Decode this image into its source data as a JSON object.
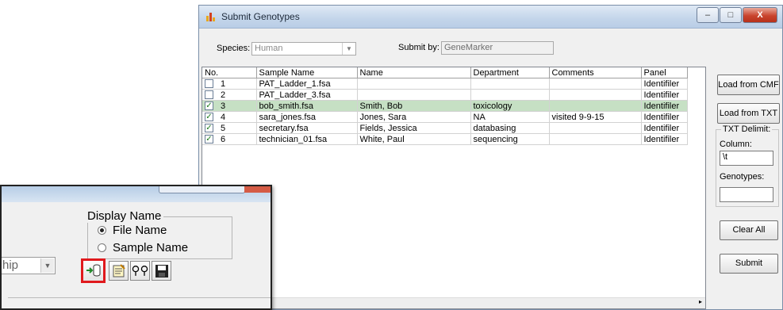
{
  "window": {
    "title": "Submit Genotypes",
    "controls": [
      "–",
      "□",
      "X"
    ]
  },
  "form": {
    "species_label": "Species:",
    "species_value": "Human",
    "submit_by_label": "Submit by:",
    "submit_by_value": "GeneMarker"
  },
  "grid": {
    "columns": [
      "No.",
      "Sample Name",
      "Name",
      "Department",
      "Comments",
      "Panel"
    ],
    "rows": [
      {
        "no": "1",
        "checked": false,
        "sample": "PAT_Ladder_1.fsa",
        "name": "",
        "dept": "",
        "comments": "",
        "panel": "Identifiler"
      },
      {
        "no": "2",
        "checked": false,
        "sample": "PAT_Ladder_3.fsa",
        "name": "",
        "dept": "",
        "comments": "",
        "panel": "Identifiler"
      },
      {
        "no": "3",
        "checked": true,
        "sample": "bob_smith.fsa",
        "name": "Smith, Bob",
        "dept": "toxicology",
        "comments": "",
        "panel": "Identifiler"
      },
      {
        "no": "4",
        "checked": true,
        "sample": "sara_jones.fsa",
        "name": "Jones, Sara",
        "dept": "NA",
        "comments": "visited 9-9-15",
        "panel": "Identifiler"
      },
      {
        "no": "5",
        "checked": true,
        "sample": "secretary.fsa",
        "name": "Fields, Jessica",
        "dept": "databasing",
        "comments": "",
        "panel": "Identifiler"
      },
      {
        "no": "6",
        "checked": true,
        "sample": "technician_01.fsa",
        "name": "White, Paul",
        "dept": "sequencing",
        "comments": "",
        "panel": "Identifiler"
      }
    ]
  },
  "side": {
    "load_cmf": "Load from CMF",
    "load_txt": "Load from TXT",
    "delimit_title": "TXT Delimit:",
    "column_label": "Column:",
    "column_value": "\\t",
    "genotypes_label": "Genotypes:",
    "genotypes_value": "",
    "clear_all": "Clear All",
    "submit": "Submit"
  },
  "inset": {
    "display_name_title": "Display Name",
    "option_file": "File Name",
    "option_sample": "Sample Name",
    "selected_option": "File Name",
    "combo_value": "hip",
    "toolbar_icons": [
      "submit-genotypes-icon",
      "notes-icon",
      "binoculars-icon",
      "save-icon"
    ]
  },
  "colors": {
    "selected_row": "#c6e0c4",
    "highlight": "#e0191d"
  }
}
